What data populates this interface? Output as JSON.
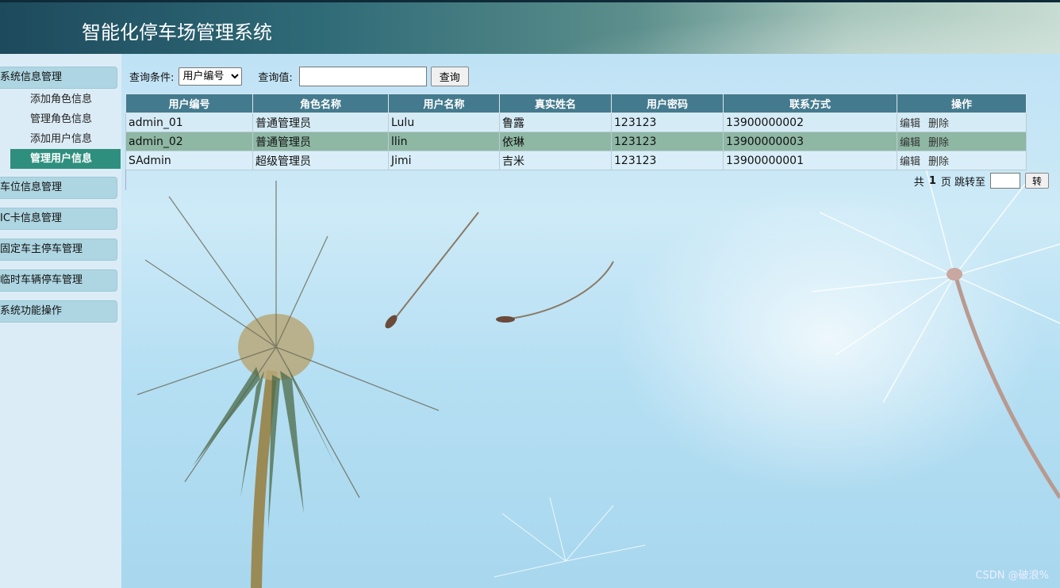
{
  "app": {
    "title": "智能化停车场管理系统"
  },
  "sidebar": {
    "groups": [
      {
        "label": "系统信息管理"
      },
      {
        "label": "车位信息管理"
      },
      {
        "label": "IC卡信息管理"
      },
      {
        "label": "固定车主停车管理"
      },
      {
        "label": "临时车辆停车管理"
      },
      {
        "label": "系统功能操作"
      }
    ],
    "sub_items": [
      {
        "label": "添加角色信息"
      },
      {
        "label": "管理角色信息"
      },
      {
        "label": "添加用户信息"
      },
      {
        "label": "管理用户信息"
      }
    ]
  },
  "search": {
    "condition_label": "查询条件:",
    "condition_selected": "用户编号",
    "value_label": "查询值:",
    "value": "",
    "button_label": "查询"
  },
  "table": {
    "headers": [
      "用户编号",
      "角色名称",
      "用户名称",
      "真实姓名",
      "用户密码",
      "联系方式",
      "操作"
    ],
    "rows": [
      {
        "id": "admin_01",
        "role": "普通管理员",
        "username": "Lulu",
        "realname": "鲁露",
        "password": "123123",
        "phone": "13900000002",
        "edit": "编辑",
        "delete": "删除"
      },
      {
        "id": "admin_02",
        "role": "普通管理员",
        "username": "llin",
        "realname": "依琳",
        "password": "123123",
        "phone": "13900000003",
        "edit": "编辑",
        "delete": "删除"
      },
      {
        "id": "SAdmin",
        "role": "超级管理员",
        "username": "Jimi",
        "realname": "吉米",
        "password": "123123",
        "phone": "13900000001",
        "edit": "编辑",
        "delete": "删除"
      }
    ]
  },
  "pager": {
    "total_prefix": "共",
    "total_pages": "1",
    "total_suffix": "页 跳转至",
    "jump_value": "",
    "go_label": "转"
  },
  "watermark": "CSDN @破浪%",
  "colors": {
    "header_start": "#1d4a5c",
    "table_header": "#447a8d",
    "active_item": "#2f8f7e",
    "highlight_row": "#8eb7a4"
  }
}
